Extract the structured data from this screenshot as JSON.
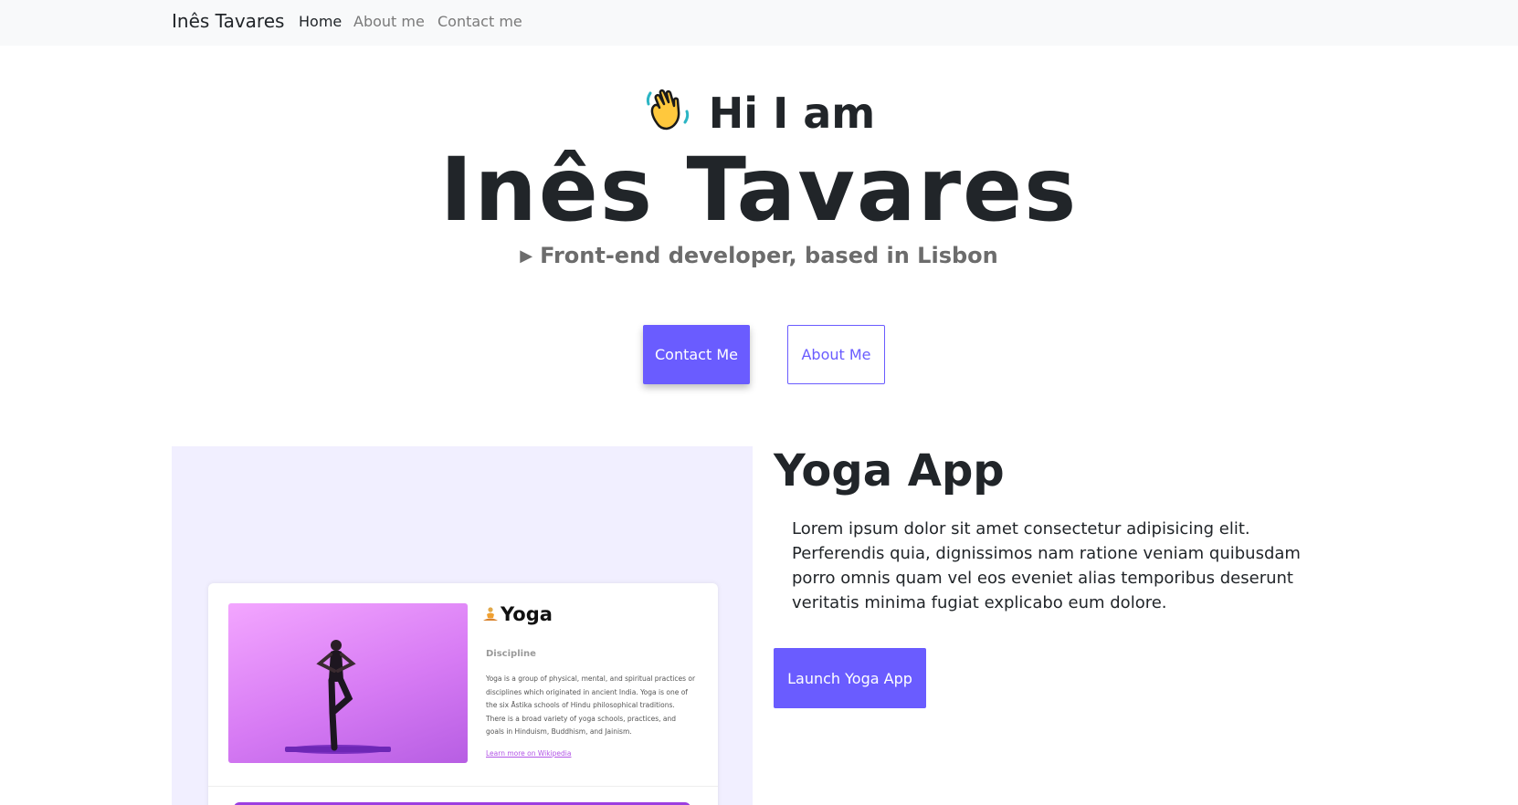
{
  "navbar": {
    "brand": "Inês Tavares",
    "links": [
      {
        "label": "Home",
        "active": true
      },
      {
        "label": "About me",
        "active": false
      },
      {
        "label": "Contact me",
        "active": false
      }
    ]
  },
  "hero": {
    "wave_icon": "waving-hand-icon",
    "greeting": "Hi I am",
    "name": "Inês Tavares",
    "subtitle": "Front-end developer, based in Lisbon",
    "subtitle_icon": "play-triangle-icon",
    "buttons": {
      "contact": "Contact Me",
      "about": "About Me"
    }
  },
  "project": {
    "title": "Yoga App",
    "description": "Lorem ipsum dolor sit amet consectetur adipisicing elit. Perferendis quia, dignissimos nam ratione veniam quibusdam porro omnis quam vel eos eveniet alias temporibus deserunt veritatis minima fugiat explicabo eum dolore.",
    "button": "Launch Yoga App",
    "preview": {
      "title": "Yoga",
      "label": "Discipline",
      "text": "Yoga is a group of physical, mental, and spiritual practices or disciplines which originated in ancient India. Yoga is one of the six Āstika schools of Hindu philosophical traditions. There is a broad variety of yoga schools, practices, and goals in Hinduism, Buddhism, and Jainism.",
      "link": "Learn more on Wikipedia"
    }
  },
  "colors": {
    "accent": "#6a5cff",
    "navbar_bg": "#f8f9fa",
    "preview_bg": "#f1efff",
    "text": "#212529",
    "muted": "#6c6c6c"
  }
}
